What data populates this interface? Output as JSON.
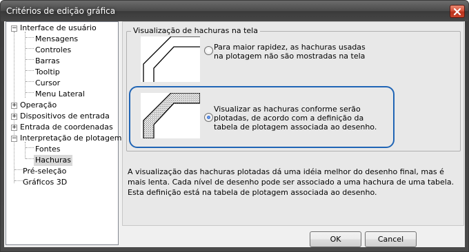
{
  "window": {
    "title": "Critérios de edição gráfica"
  },
  "tree": {
    "items": [
      {
        "label": "Interface de usuário",
        "expander": "−"
      },
      {
        "label": "Mensagens"
      },
      {
        "label": "Controles"
      },
      {
        "label": "Barras"
      },
      {
        "label": "Tooltip"
      },
      {
        "label": "Cursor"
      },
      {
        "label": "Menu Lateral"
      },
      {
        "label": "Operação",
        "expander": "+"
      },
      {
        "label": "Dispositivos de entrada",
        "expander": "+"
      },
      {
        "label": "Entrada de coordenadas",
        "expander": "+"
      },
      {
        "label": "Interpretação de plotagem",
        "expander": "−"
      },
      {
        "label": "Fontes"
      },
      {
        "label": "Hachuras",
        "selected": true
      },
      {
        "label": "Pré-seleção"
      },
      {
        "label": "Gráficos 3D"
      }
    ]
  },
  "group": {
    "title": "Visualização de hachuras na tela",
    "option1": "Para maior rapidez, as hachuras usadas na plotagem não são mostradas na tela",
    "option2": "Visualizar as hachuras conforme serão plotadas, de acordo com a definição da tabela de plotagem associada ao desenho.",
    "selected": 2
  },
  "description": "A visualização das hachuras plotadas dá uma idéia melhor do desenho final, mas é mais lenta. Cada nível de desenho pode ser associado a uma hachura de uma tabela. Esta definição está na tabela de plotagem associada ao desenho.",
  "buttons": {
    "ok": "OK",
    "cancel": "Cancel"
  },
  "colors": {
    "highlight": "#1f64b5",
    "close": "#c9452c"
  }
}
